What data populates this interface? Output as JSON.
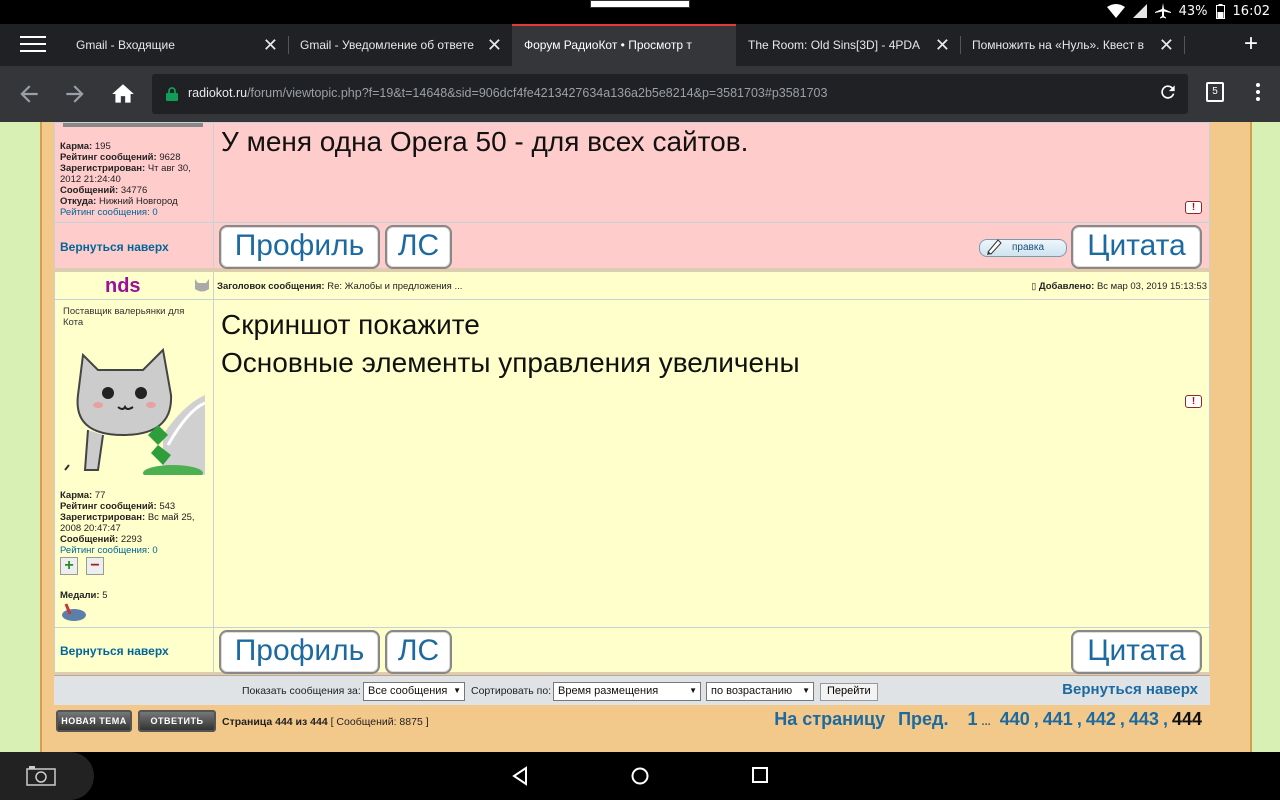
{
  "status": {
    "battery": "43%",
    "time": "16:02"
  },
  "tabs": [
    {
      "title": "Gmail - Входящие"
    },
    {
      "title": "Gmail - Уведомление об ответе"
    },
    {
      "title": "Форум РадиоКот • Просмотр т"
    },
    {
      "title": "The Room: Old Sins[3D] - 4PDA"
    },
    {
      "title": "Помножить на «Нуль». Квест в"
    }
  ],
  "tab_count": "5",
  "url": {
    "host": "radiokot.ru",
    "path": "/forum/viewtopic.php?f=19&t=14648&sid=906dcf4fe4213427634a136a2b5e8214&p=3581703#p3581703"
  },
  "post1": {
    "stats": [
      {
        "label": "Карма:",
        "value": "195"
      },
      {
        "label": "Рейтинг сообщений:",
        "value": "9628"
      },
      {
        "label": "Зарегистрирован:",
        "value": "Чт авг 30, 2012 21:24:40"
      },
      {
        "label": "Сообщений:",
        "value": "34776"
      },
      {
        "label": "Откуда:",
        "value": "Нижний Новгород"
      }
    ],
    "rating_link": "Рейтинг сообщения:",
    "rating_value": "0",
    "text": "У меня одна Opera 50 - для всех сайтов.",
    "back_to_top": "Вернуться наверх",
    "profile_btn": "Профиль",
    "pm_btn": "ЛС",
    "edit_btn": "правка",
    "quote_btn": "Цитата"
  },
  "post2": {
    "author": "nds",
    "subject_label": "Заголовок сообщения:",
    "subject": "Re: Жалобы и предложения ...",
    "added_label": "Добавлено:",
    "added": "Вс мар 03, 2019 15:13:53",
    "rank": "Поставщик валерьянки для Кота",
    "stats": [
      {
        "label": "Карма:",
        "value": "77"
      },
      {
        "label": "Рейтинг сообщений:",
        "value": "543"
      },
      {
        "label": "Зарегистрирован:",
        "value": "Вс май 25, 2008 20:47:47"
      },
      {
        "label": "Сообщений:",
        "value": "2293"
      }
    ],
    "rating_link": "Рейтинг сообщения:",
    "rating_value": "0",
    "medals_label": "Медали:",
    "medals": "5",
    "text_line1": "Скриншот покажите",
    "text_line2": "Основные элементы управления увеличены",
    "back_to_top": "Вернуться наверх",
    "profile_btn": "Профиль",
    "pm_btn": "ЛС",
    "quote_btn": "Цитата"
  },
  "sortbar": {
    "show_label": "Показать сообщения за:",
    "show_value": "Все сообщения",
    "sort_label": "Сортировать по:",
    "sort_value": "Время размещения",
    "order_value": "по возрастанию",
    "go_btn": "Перейти",
    "back_to_top": "Вернуться наверх"
  },
  "pager": {
    "new_topic": "НОВАЯ ТЕМА",
    "reply": "ОТВЕТИТЬ",
    "page_info": "Страница 444 из 444",
    "msg_count": "[ Сообщений: 8875 ]",
    "goto_label": "На страницу",
    "prev": "Пред.",
    "p1": "1",
    "dots": "...",
    "p440": "440",
    "p441": "441",
    "p442": "442",
    "p443": "443",
    "current": "444"
  }
}
